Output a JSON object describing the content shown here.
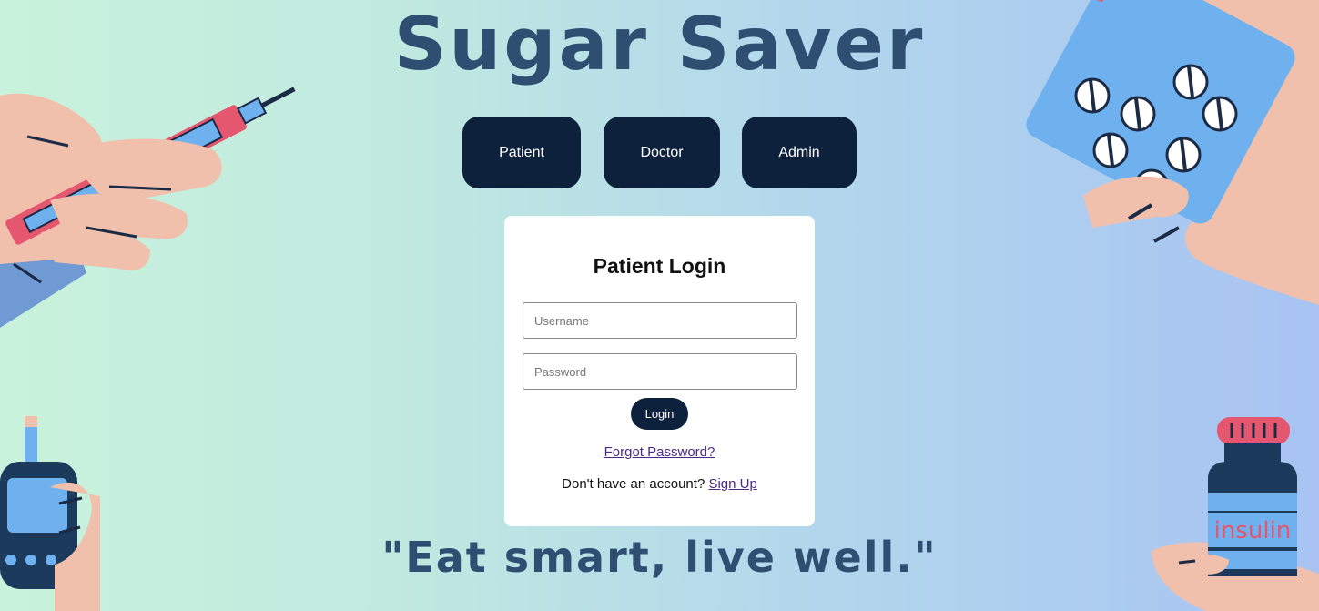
{
  "app": {
    "title": "Sugar Saver",
    "tagline": "\"Eat smart, live well.\""
  },
  "roles": [
    {
      "label": "Patient"
    },
    {
      "label": "Doctor"
    },
    {
      "label": "Admin"
    }
  ],
  "login": {
    "heading": "Patient Login",
    "username_placeholder": "Username",
    "password_placeholder": "Password",
    "submit_label": "Login",
    "forgot_link": "Forgot Password?",
    "signup_prompt": "Don't have an account?",
    "signup_link": "Sign Up"
  },
  "illustrations": {
    "bottle_label": "insulin",
    "icons": [
      "insulin-pen-icon",
      "pill-pack-icon",
      "glucose-meter-icon",
      "insulin-bottle-icon"
    ]
  },
  "colors": {
    "primary_dark": "#0d213c",
    "title": "#2f4f72",
    "link": "#4c2a86",
    "accent_red": "#e5566f",
    "accent_blue": "#6fb0ee",
    "skin": "#f0c0ad"
  }
}
